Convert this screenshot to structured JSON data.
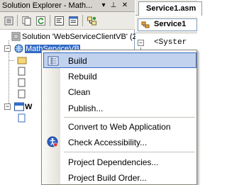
{
  "solution_explorer": {
    "title": "Solution Explorer - Math...",
    "pin_glyph": "▾",
    "autohide_glyph": "⊥",
    "close_glyph": "✕",
    "toolbar_icons": [
      "properties-icon",
      "show-all-files-icon",
      "refresh-icon",
      "view-code-icon",
      "view-designer-icon",
      "class-diagram-icon"
    ],
    "tree": {
      "solution_label": "Solution 'WebServiceClientVB' (2",
      "project_label": "MathServiceVB",
      "second_project_label": "W"
    }
  },
  "editor": {
    "tab_label": "Service1.asm",
    "combo_label": "Service1",
    "code_lines": [
      "<Syster"
    ],
    "collapse_glyph": "−"
  },
  "context_menu": {
    "items": [
      {
        "label": "Build",
        "highlighted": true,
        "icon": "build-icon"
      },
      {
        "label": "Rebuild"
      },
      {
        "label": "Clean"
      },
      {
        "label": "Publish..."
      },
      {
        "label": "Convert to Web Application"
      },
      {
        "label": "Check Accessibility...",
        "icon": "accessibility-icon"
      },
      {
        "label": "Project Dependencies..."
      },
      {
        "label": "Project Build Order..."
      }
    ]
  },
  "colors": {
    "menu_highlight_fill": "#c1d2ee",
    "menu_highlight_border": "#316ac5",
    "project_selection": "#316ac5",
    "accent_blue": "#1a5fb4"
  }
}
